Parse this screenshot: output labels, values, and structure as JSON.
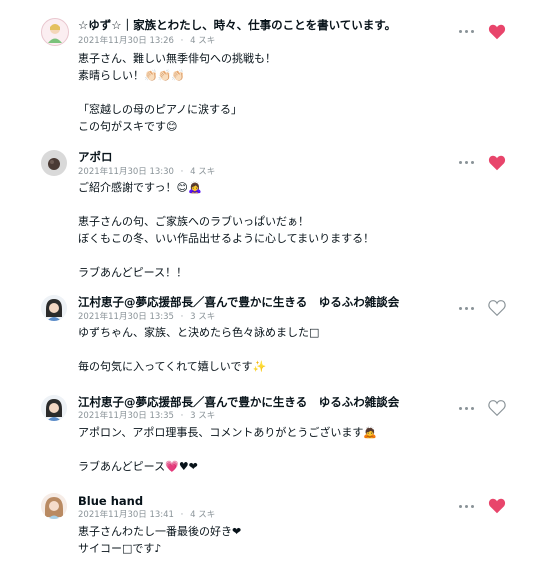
{
  "comments": [
    {
      "name": "☆ゆず☆｜家族とわたし、時々、仕事のことを書いています。",
      "timestamp": "2021年11月30日 13:26",
      "separator": "·",
      "likes": "4 スキ",
      "body": "恵子さん、難しい無季俳句への挑戦も！\n素晴らしい！👏🏻👏🏻👏🏻\n\n「窓越しの母のピアノに涙する」\nこの句がスキです😊",
      "liked": true,
      "avatar_icon": "user-avatar-icon"
    },
    {
      "name": "アポロ",
      "timestamp": "2021年11月30日 13:30",
      "separator": "·",
      "likes": "4 スキ",
      "body": "ご紹介感謝ですっ！😊🙇‍♀️\n\n恵子さんの句、ご家族へのラブいっぱいだぁ！\nぼくもこの冬、いい作品出せるように心してまいりまする！\n\nラブあんどピース！！",
      "liked": true,
      "avatar_icon": "user-avatar-icon"
    },
    {
      "name": "江村恵子@夢応援部長／喜んで豊かに生きる　ゆるふわ雑談会",
      "timestamp": "2021年11月30日 13:35",
      "separator": "·",
      "likes": "3 スキ",
      "body": "ゆずちゃん、家族、と決めたら色々詠めました□\n\n毎の句気に入ってくれて嬉しいです✨",
      "liked": false,
      "avatar_icon": "user-avatar-icon"
    },
    {
      "name": "江村恵子@夢応援部長／喜んで豊かに生きる　ゆるふわ雑談会",
      "timestamp": "2021年11月30日 13:35",
      "separator": "·",
      "likes": "3 スキ",
      "body": "アポロン、アポロ理事長、コメントありがとうございます🙇\n\nラブあんどピース💗♥❤",
      "liked": false,
      "avatar_icon": "user-avatar-icon"
    },
    {
      "name": "Blue hand",
      "timestamp": "2021年11月30日 13:41",
      "separator": "·",
      "likes": "4 スキ",
      "body": "恵子さんわたし一番最後の好き❤\nサイコー□です♪",
      "liked": true,
      "avatar_icon": "user-avatar-icon"
    }
  ],
  "colors": {
    "heart_liked": "#e8456b",
    "heart_unliked": "#8a9398",
    "meta_text": "#8a9398",
    "body_text": "#08131a"
  }
}
